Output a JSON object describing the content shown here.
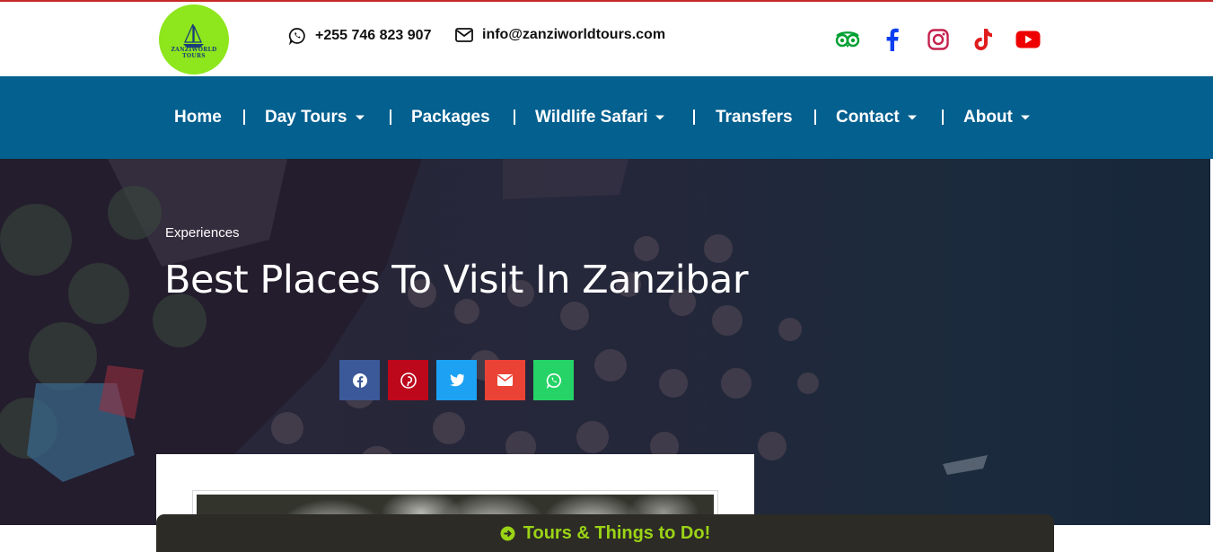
{
  "header": {
    "logo_text": "ZANZIWORLD TOURS",
    "logo_icon": "sailboat-icon",
    "phone": "+255 746 823 907",
    "phone_icon": "whatsapp-icon",
    "email": "info@zanziworldtours.com",
    "email_icon": "envelope-icon",
    "social": [
      {
        "name": "tripadvisor-icon",
        "color": "#00a033"
      },
      {
        "name": "facebook-icon",
        "color": "#0a3ef0"
      },
      {
        "name": "instagram-icon",
        "color": "#c4214b"
      },
      {
        "name": "tiktok-icon",
        "color": "#e01c1c"
      },
      {
        "name": "youtube-icon",
        "color": "#ee0000"
      }
    ]
  },
  "nav": {
    "background": "#03608f",
    "items": [
      {
        "label": "Home",
        "dropdown": false
      },
      {
        "label": "Day Tours",
        "dropdown": true
      },
      {
        "label": "Packages",
        "dropdown": false
      },
      {
        "label": "Wildlife Safari",
        "dropdown": true
      },
      {
        "label": "Transfers",
        "dropdown": false
      },
      {
        "label": "Contact",
        "dropdown": true
      },
      {
        "label": "About",
        "dropdown": true
      }
    ]
  },
  "hero": {
    "category": "Experiences",
    "title": "Best Places To Visit In Zanzibar",
    "share_buttons": [
      {
        "name": "facebook-icon",
        "color": "#3b5998"
      },
      {
        "name": "pinterest-icon",
        "color": "#bd081c"
      },
      {
        "name": "twitter-icon",
        "color": "#1da1f2"
      },
      {
        "name": "email-icon",
        "color": "#ea4335"
      },
      {
        "name": "whatsapp-icon",
        "color": "#25d366"
      }
    ]
  },
  "bottom_bar": {
    "label": "Tours & Things to Do!",
    "icon": "arrow-circle-right-icon",
    "color": "#9bd415"
  }
}
